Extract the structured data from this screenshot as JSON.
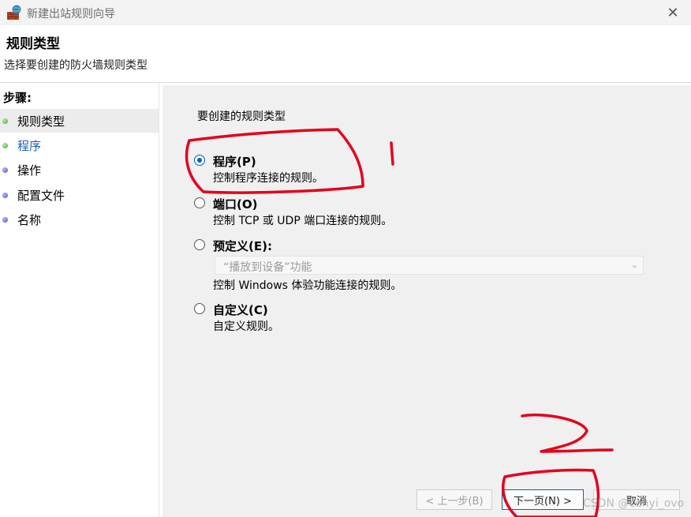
{
  "window": {
    "title": "新建出站规则向导",
    "close_glyph": "✕"
  },
  "header": {
    "title": "规则类型",
    "subtitle": "选择要创建的防火墙规则类型"
  },
  "steps": {
    "heading": "步骤:",
    "items": [
      {
        "label": "规则类型",
        "state": "current"
      },
      {
        "label": "程序",
        "state": "link"
      },
      {
        "label": "操作",
        "state": "pending"
      },
      {
        "label": "配置文件",
        "state": "pending"
      },
      {
        "label": "名称",
        "state": "pending"
      }
    ]
  },
  "main": {
    "question": "要创建的规则类型",
    "options": [
      {
        "label": "程序(P)",
        "desc": "控制程序连接的规则。",
        "checked": true
      },
      {
        "label": "端口(O)",
        "desc": "控制 TCP 或 UDP 端口连接的规则。",
        "checked": false
      },
      {
        "label": "预定义(E):",
        "desc": "控制 Windows 体验功能连接的规则。",
        "checked": false
      },
      {
        "label": "自定义(C)",
        "desc": "自定义规则。",
        "checked": false
      }
    ],
    "predefined_select": {
      "value": "“播放到设备”功能",
      "arrow": "⌄"
    }
  },
  "buttons": {
    "back": "< 上一步(B)",
    "next": "下一页(N) >",
    "cancel": "取消"
  },
  "annotations": {
    "mark1": "1",
    "mark2": "2",
    "color": "#e4001b"
  },
  "watermark": "CSDN @cehyi_ovo"
}
